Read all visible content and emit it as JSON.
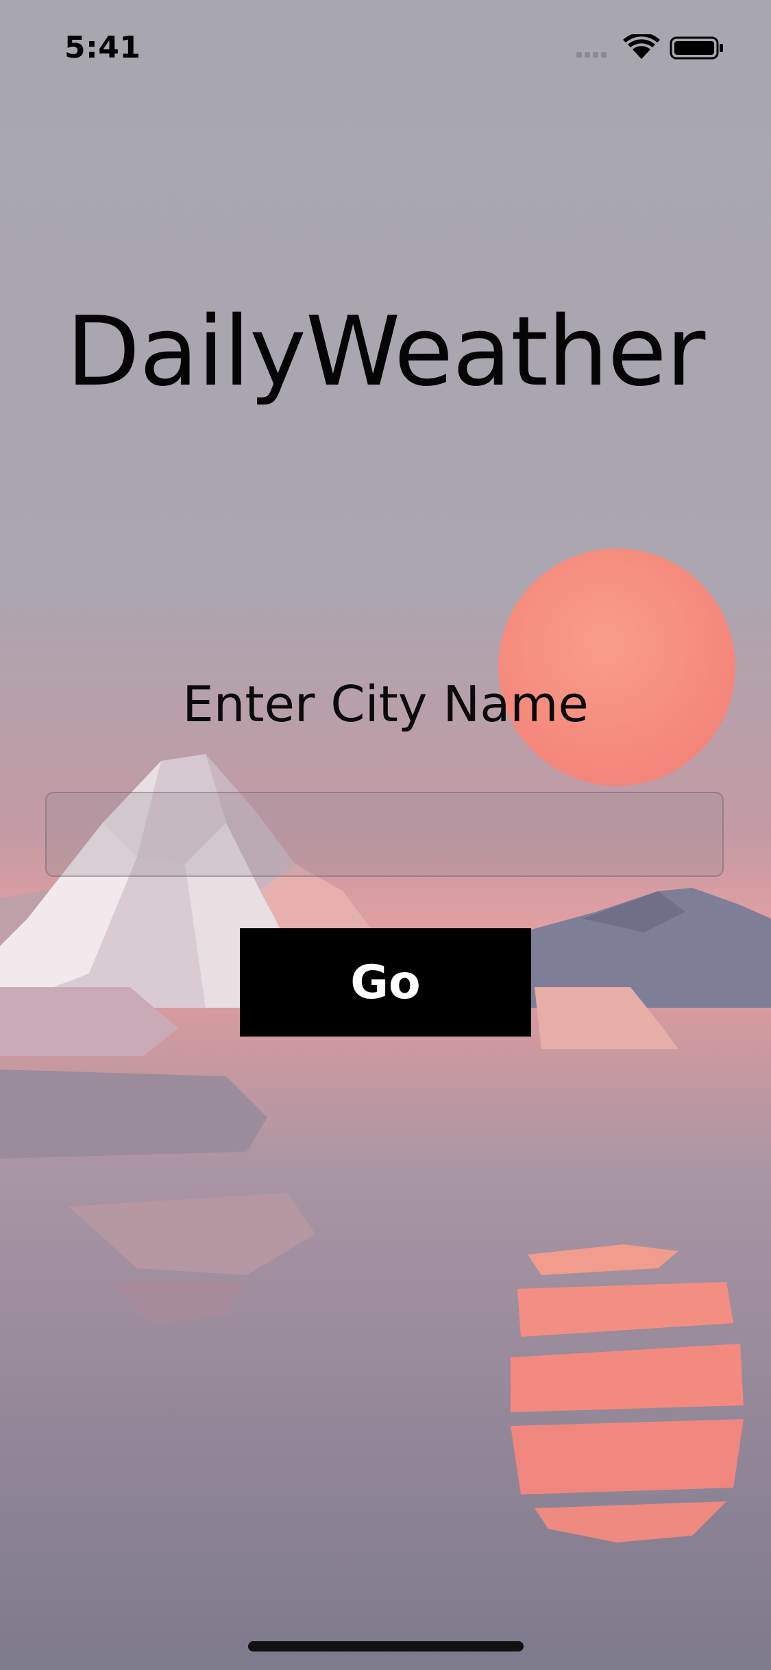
{
  "status_bar": {
    "time": "5:41",
    "icons": [
      "signal-icon",
      "wifi-icon",
      "battery-icon"
    ]
  },
  "app": {
    "title": "DailyWeather"
  },
  "form": {
    "prompt_label": "Enter City Name",
    "city_input_value": "",
    "go_button_label": "Go"
  },
  "background": {
    "name": "low-poly sunset lake with iceberg and sun reflection",
    "sky_color": "#a9a8b0",
    "sun_color": "#f58b7a",
    "water_color": "#8c8596"
  }
}
